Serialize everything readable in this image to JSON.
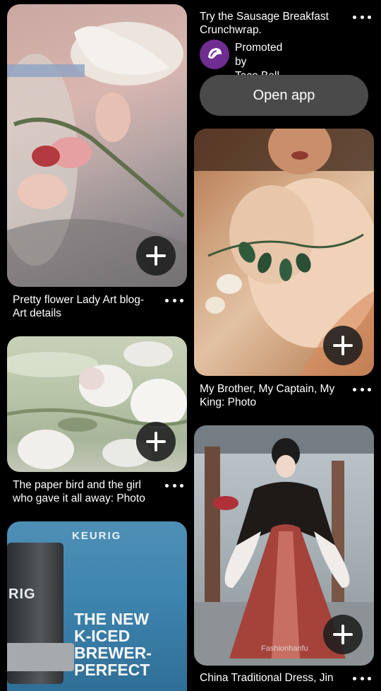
{
  "ad": {
    "title": "Try the Sausage Breakfast Crunchwrap.",
    "promoted_by": "Promoted by",
    "advertiser": "Taco Bell",
    "open_app_label": "Open app"
  },
  "pins": {
    "p1": {
      "title": "Pretty flower Lady Art blog- Art details"
    },
    "p2": {
      "title": "The paper bird and the girl who gave it all away: Photo"
    },
    "p3": {
      "brand_text": "KEURIG",
      "side_text": "RIG",
      "headline": "THE NEW K-ICED BREWER- PERFECT"
    },
    "p4": {
      "title": "My Brother, My Captain, My King: Photo"
    },
    "p5": {
      "title": "China Traditional Dress, Jin",
      "watermark": "Fashionhanfu"
    }
  },
  "colors": {
    "background": "#000000",
    "button": "#4a4a4a",
    "taco_bell_purple": "#6f2d91"
  },
  "icons": [
    "plus-icon",
    "more-options-icon",
    "taco-bell-logo"
  ]
}
